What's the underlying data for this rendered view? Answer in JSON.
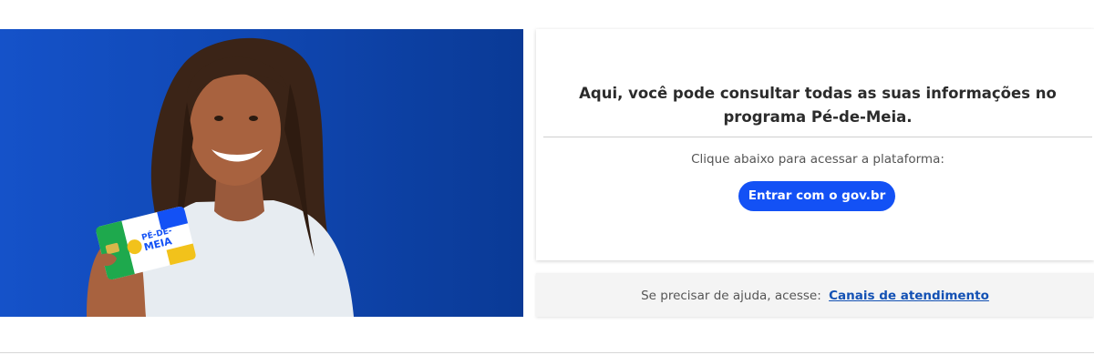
{
  "hero": {
    "card_logo_line1": "PÉ-DE-",
    "card_logo_line2": "MEIA"
  },
  "info_card": {
    "title": "Aqui, você pode consultar todas as suas informações no programa Pé-de-Meia.",
    "subtitle": "Clique abaixo para acessar a plataforma:",
    "login_button_label": "Entrar com o gov.br"
  },
  "help_bar": {
    "text": "Se precisar de ajuda, acesse:",
    "link_label": "Canais de atendimento"
  },
  "colors": {
    "primary_blue": "#1351f5",
    "hero_blue": "#1552c9",
    "link_blue": "#1351b4"
  }
}
